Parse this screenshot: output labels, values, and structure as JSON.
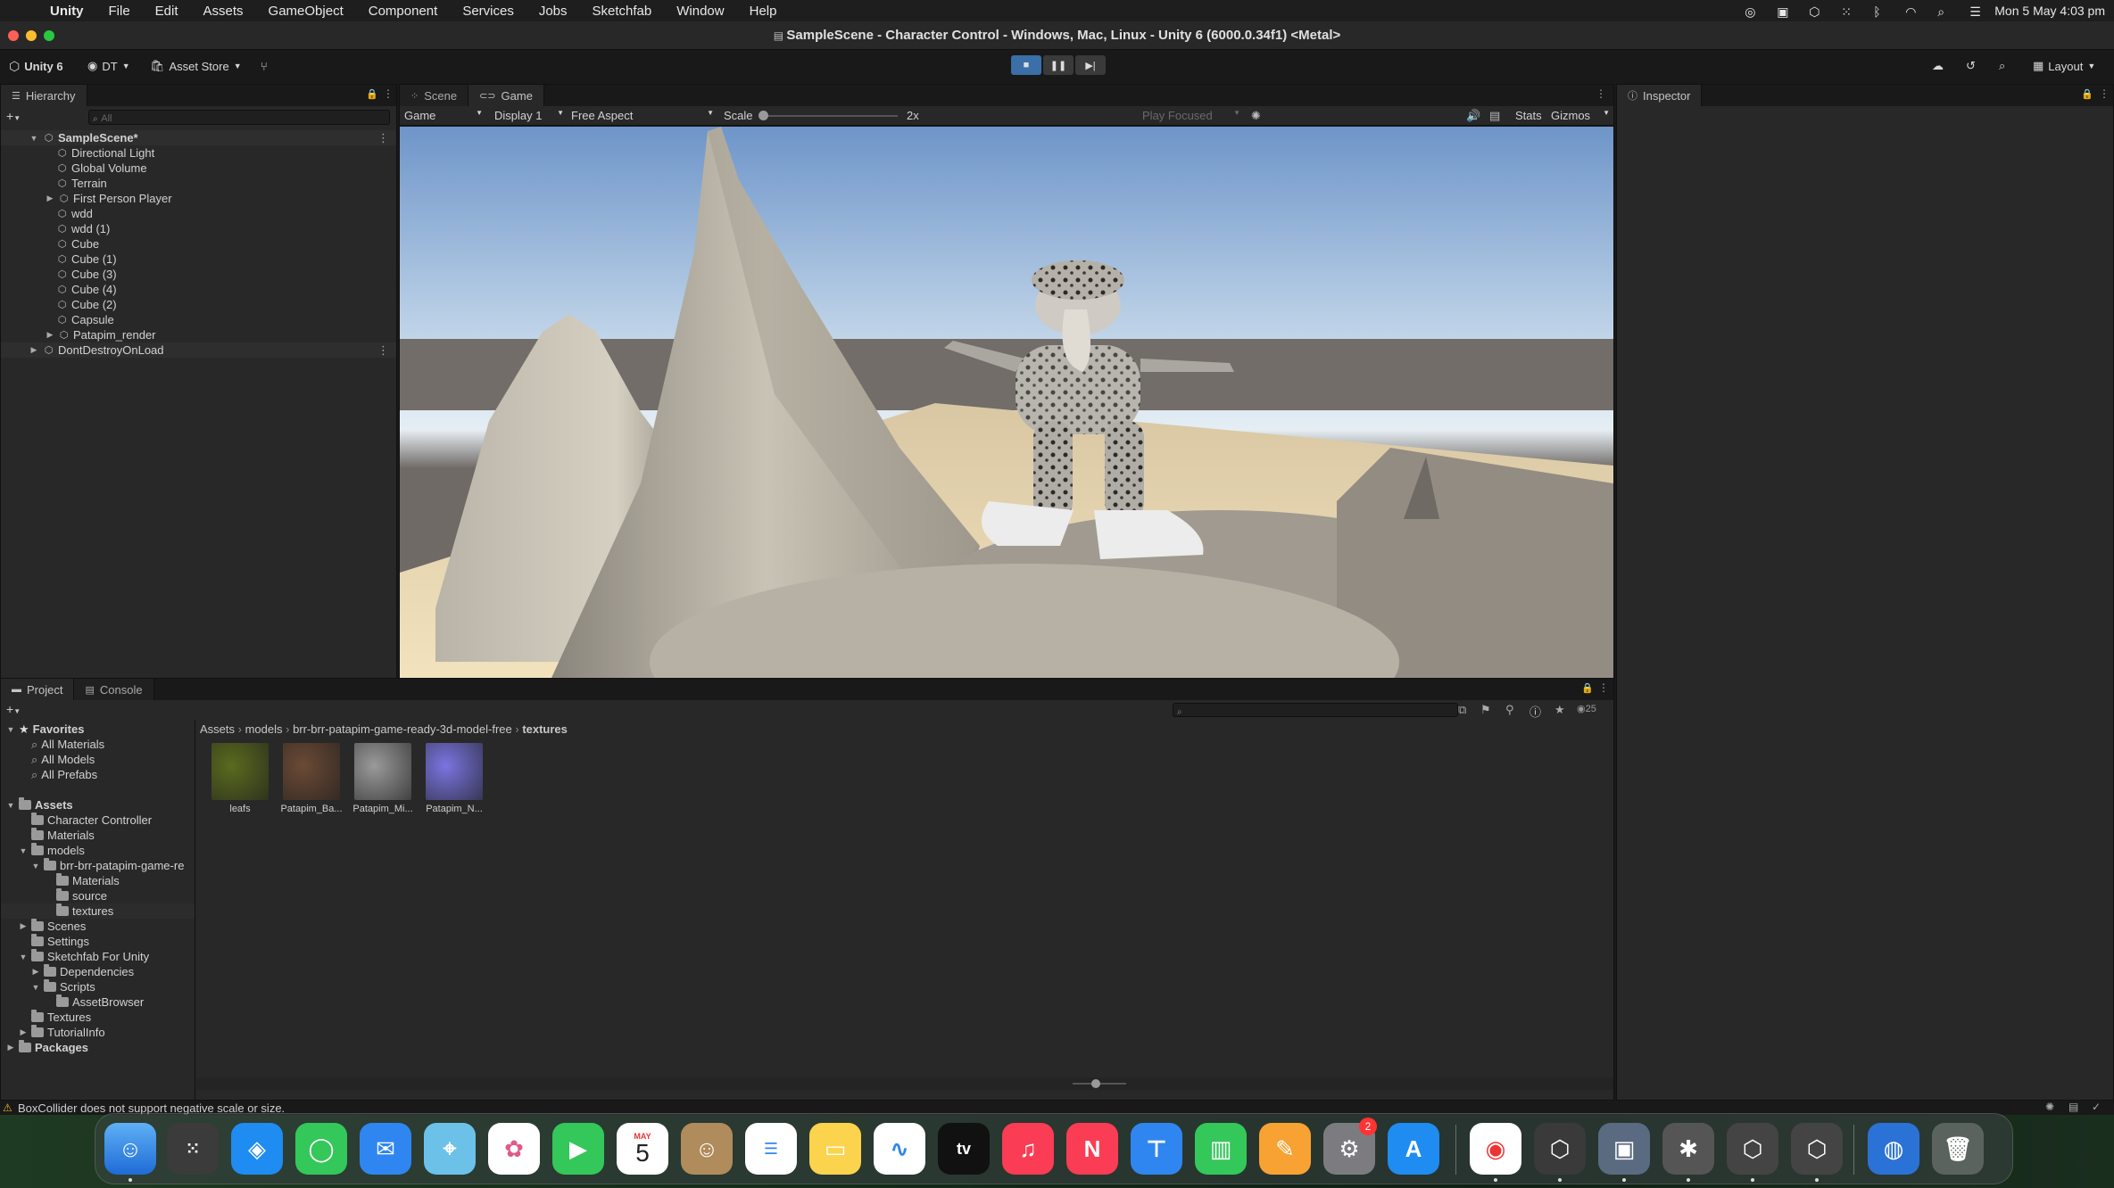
{
  "menubar": {
    "app": "Unity",
    "items": [
      "File",
      "Edit",
      "Assets",
      "GameObject",
      "Component",
      "Services",
      "Jobs",
      "Sketchfab",
      "Window",
      "Help"
    ],
    "clock": "Mon 5 May  4:03 pm"
  },
  "window": {
    "title": "SampleScene - Character Control - Windows, Mac, Linux - Unity 6 (6000.0.34f1) <Metal>"
  },
  "toolbar": {
    "unity_version": "Unity 6",
    "account": "DT",
    "asset_store": "Asset Store",
    "layout": "Layout"
  },
  "hierarchy": {
    "tab": "Hierarchy",
    "search_placeholder": "All",
    "scene": "SampleScene*",
    "items": [
      "Directional Light",
      "Global Volume",
      "Terrain",
      "First Person Player",
      "wdd",
      "wdd (1)",
      "Cube",
      "Cube (1)",
      "Cube (3)",
      "Cube (4)",
      "Cube (2)",
      "Capsule",
      "Patapim_render"
    ],
    "ddol": "DontDestroyOnLoad"
  },
  "game": {
    "tabs": [
      "Scene",
      "Game"
    ],
    "mode": "Game",
    "display": "Display 1",
    "aspect": "Free Aspect",
    "scale_label": "Scale",
    "scale_value": "2x",
    "play_focused": "Play Focused",
    "stats": "Stats",
    "gizmos": "Gizmos"
  },
  "inspector": {
    "tab": "Inspector"
  },
  "project": {
    "tabs": [
      "Project",
      "Console"
    ],
    "favorites_label": "Favorites",
    "favorites": [
      "All Materials",
      "All Models",
      "All Prefabs"
    ],
    "assets_label": "Assets",
    "tree": [
      {
        "label": "Character Controller",
        "depth": 1,
        "arrow": ""
      },
      {
        "label": "Materials",
        "depth": 1,
        "arrow": ""
      },
      {
        "label": "models",
        "depth": 1,
        "arrow": "▼"
      },
      {
        "label": "brr-brr-patapim-game-re",
        "depth": 2,
        "arrow": "▼"
      },
      {
        "label": "Materials",
        "depth": 3,
        "arrow": ""
      },
      {
        "label": "source",
        "depth": 3,
        "arrow": ""
      },
      {
        "label": "textures",
        "depth": 3,
        "arrow": ""
      },
      {
        "label": "Scenes",
        "depth": 1,
        "arrow": "▶"
      },
      {
        "label": "Settings",
        "depth": 1,
        "arrow": ""
      },
      {
        "label": "Sketchfab For Unity",
        "depth": 1,
        "arrow": "▼"
      },
      {
        "label": "Dependencies",
        "depth": 2,
        "arrow": "▶"
      },
      {
        "label": "Scripts",
        "depth": 2,
        "arrow": "▼"
      },
      {
        "label": "AssetBrowser",
        "depth": 3,
        "arrow": ""
      },
      {
        "label": "Textures",
        "depth": 1,
        "arrow": ""
      },
      {
        "label": "TutorialInfo",
        "depth": 1,
        "arrow": "▶"
      }
    ],
    "packages_label": "Packages",
    "breadcrumb": [
      "Assets",
      "models",
      "brr-brr-patapim-game-ready-3d-model-free",
      "textures"
    ],
    "asset_count": "25",
    "assets": [
      {
        "label": "leafs",
        "color": "#5a6b1e"
      },
      {
        "label": "Patapim_Ba...",
        "color": "#6b4a35"
      },
      {
        "label": "Patapim_Mi...",
        "color": "#9a9a9a"
      },
      {
        "label": "Patapim_N...",
        "color": "#7a75e0"
      }
    ]
  },
  "status": {
    "message": "BoxCollider does not support negative scale or size."
  },
  "dock": {
    "calendar_month": "MAY",
    "calendar_day": "5",
    "settings_badge": "2"
  }
}
